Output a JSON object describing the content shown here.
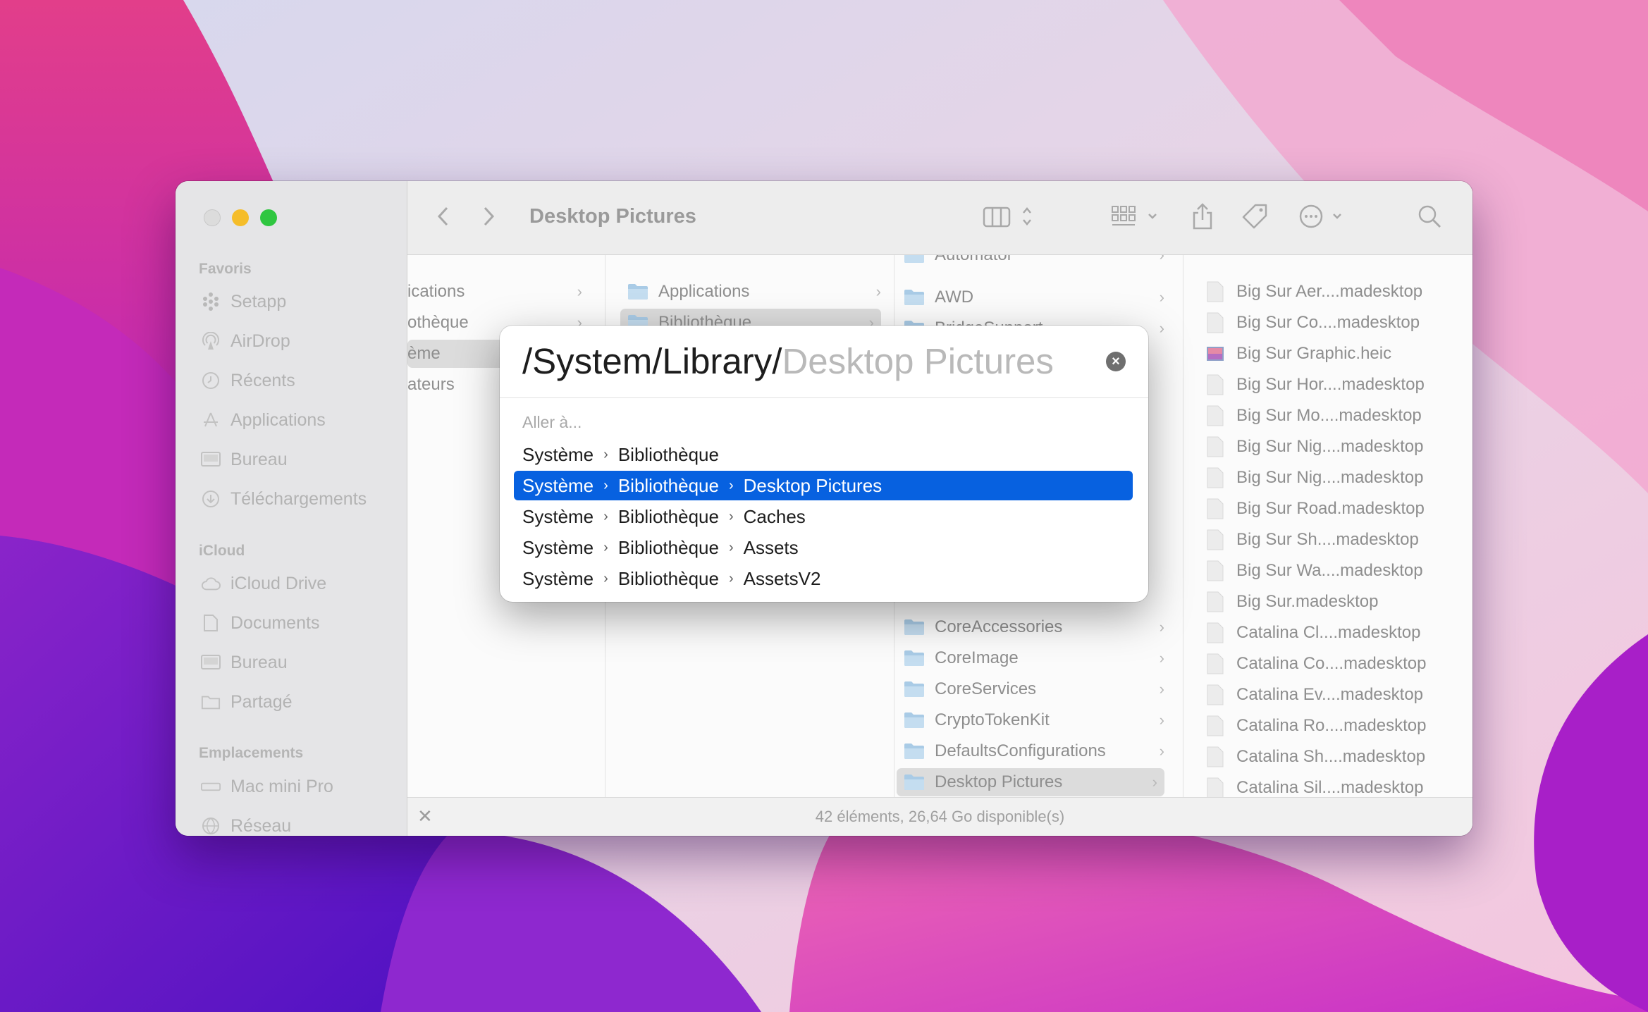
{
  "window": {
    "title": "Desktop Pictures",
    "colors": {
      "close": "#dcdcdc",
      "minimize": "#f5bd2a",
      "maximize": "#2fc640",
      "accent": "#0761e0"
    }
  },
  "sidebar": {
    "favorites_label": "Favoris",
    "favorites": [
      {
        "label": "Setapp",
        "icon": "setapp-icon"
      },
      {
        "label": "AirDrop",
        "icon": "airdrop-icon"
      },
      {
        "label": "Récents",
        "icon": "clock-icon"
      },
      {
        "label": "Applications",
        "icon": "applications-icon"
      },
      {
        "label": "Bureau",
        "icon": "desktop-icon"
      },
      {
        "label": "Téléchargements",
        "icon": "download-icon"
      }
    ],
    "icloud_label": "iCloud",
    "icloud": [
      {
        "label": "iCloud Drive",
        "icon": "cloud-icon"
      },
      {
        "label": "Documents",
        "icon": "document-icon"
      },
      {
        "label": "Bureau",
        "icon": "desktop-icon"
      },
      {
        "label": "Partagé",
        "icon": "shared-folder-icon"
      }
    ],
    "locations_label": "Emplacements",
    "locations": [
      {
        "label": "Mac mini Pro",
        "icon": "computer-icon"
      },
      {
        "label": "Réseau",
        "icon": "network-icon"
      }
    ]
  },
  "columns": {
    "col1": [
      "ications",
      "othèque",
      "ème",
      "ateurs"
    ],
    "col2": [
      "Applications",
      "Bibliothèque"
    ],
    "col3_top": [
      "Automator",
      "AWD",
      "BridgeSupport"
    ],
    "col3_bottom": [
      "CoreAccessories",
      "CoreImage",
      "CoreServices",
      "CryptoTokenKit",
      "DefaultsConfigurations",
      "Desktop Pictures"
    ],
    "col4": [
      "Big Sur Aer....madesktop",
      "Big Sur Co....madesktop",
      "Big Sur Graphic.heic",
      "Big Sur Hor....madesktop",
      "Big Sur Mo....madesktop",
      "Big Sur Nig....madesktop",
      "Big Sur Nig....madesktop",
      "Big Sur Road.madesktop",
      "Big Sur Sh....madesktop",
      "Big Sur Wa....madesktop",
      "Big Sur.madesktop",
      "Catalina Cl....madesktop",
      "Catalina Co....madesktop",
      "Catalina Ev....madesktop",
      "Catalina Ro....madesktop",
      "Catalina Sh....madesktop",
      "Catalina Sil....madesktop"
    ]
  },
  "status": {
    "text": "42 éléments, 26,64 Go disponible(s)"
  },
  "dialog": {
    "typed": "/System/Library/",
    "completion": "Desktop Pictures",
    "caption": "Aller à...",
    "suggestions": [
      [
        "Système",
        "Bibliothèque"
      ],
      [
        "Système",
        "Bibliothèque",
        "Desktop Pictures"
      ],
      [
        "Système",
        "Bibliothèque",
        "Caches"
      ],
      [
        "Système",
        "Bibliothèque",
        "Assets"
      ],
      [
        "Système",
        "Bibliothèque",
        "AssetsV2"
      ]
    ],
    "selected_index": 1
  }
}
